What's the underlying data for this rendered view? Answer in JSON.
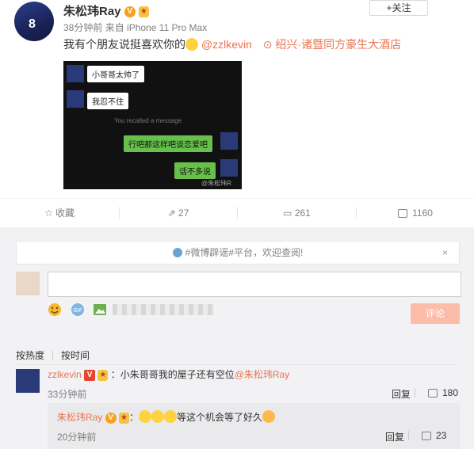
{
  "post": {
    "author": "朱松玮Ray",
    "verified_badge": "V",
    "follow_label": "+关注",
    "time": "38分钟前",
    "source": "来自 iPhone 11 Pro Max",
    "text": "我有个朋友说挺喜欢你的",
    "mention": "@zzlkevin",
    "location": "绍兴·诸暨同方豪生大酒店",
    "image": {
      "messages": [
        {
          "side": "left",
          "text": "小哥哥太帅了"
        },
        {
          "side": "left",
          "text": "我忍不住"
        },
        {
          "side": "right",
          "text": "行吧那这样吧谈恋爱吧"
        },
        {
          "side": "right",
          "text": "话不多说"
        }
      ],
      "recalled": "You recalled a message",
      "watermark": "@朱松玮R"
    }
  },
  "actions": {
    "favorite": "收藏",
    "repost_count": "27",
    "comment_count": "261",
    "like_count": "1160"
  },
  "comments_area": {
    "notice": "#微博辟谣#平台，欢迎查阅!",
    "close": "×",
    "input_placeholder": "",
    "submit_label": "评论",
    "sort_hot": "按热度",
    "sort_time": "按时间"
  },
  "comments": [
    {
      "author": "zzlkevin",
      "text": "：小朱哥哥我的屋子还有空位",
      "mention": "@朱松玮Ray",
      "time": "33分钟前",
      "reply_label": "回复",
      "likes": "180"
    },
    {
      "author": "朱松玮Ray",
      "text": "等这个机会等了好久",
      "time": "20分钟前",
      "reply_label": "回复",
      "likes": "23"
    }
  ],
  "colors": {
    "link": "#eb7350",
    "badge": "#f9a11b",
    "submit_bg": "#fcbcaa",
    "area_bg": "#f2f2f5"
  }
}
